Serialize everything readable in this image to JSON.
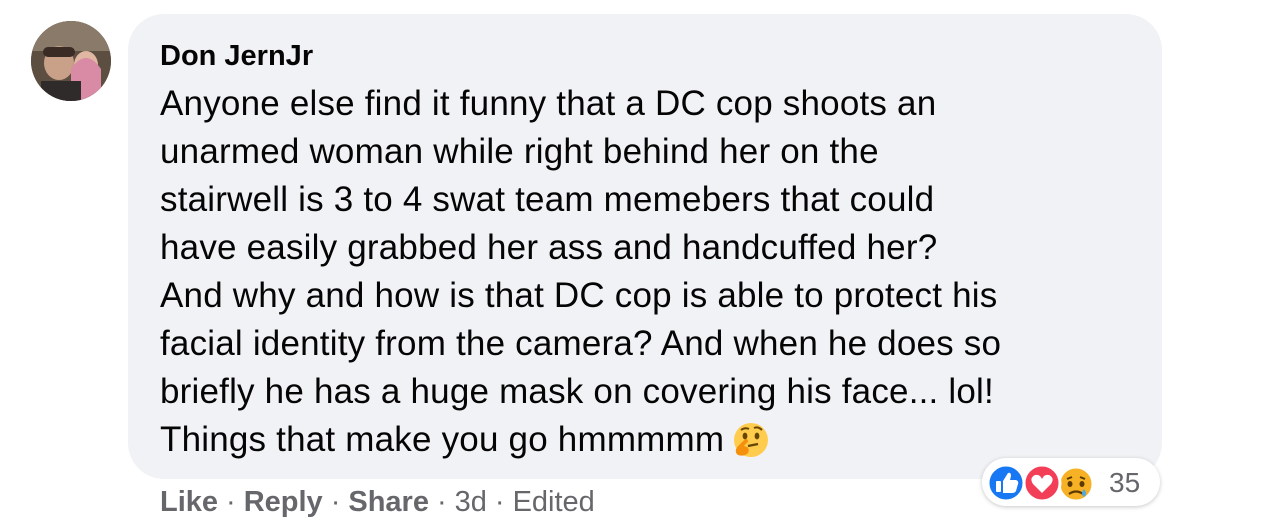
{
  "comment": {
    "author": "Don JernJr",
    "lines": [
      "Anyone else find it funny that a DC cop shoots an",
      "unarmed woman while right behind her on the",
      "stairwell is 3 to 4 swat team memebers that could",
      "have easily grabbed her ass and handcuffed her?",
      "And why and how is that DC cop is able to protect his",
      "facial identity from the camera? And when he does so",
      "briefly he has a huge mask on covering his face... lol!",
      "Things that make you go hmmmmm"
    ],
    "trailing_emoji": "thinking-face-emoji"
  },
  "reactions": {
    "types": [
      "like-icon",
      "love-icon",
      "sad-icon"
    ],
    "count": "35",
    "colors": {
      "like": "#1877f2",
      "love": "#f33e58",
      "sad": "#f7b125"
    }
  },
  "actions": {
    "like": "Like",
    "reply": "Reply",
    "share": "Share",
    "time": "3d",
    "edited": "Edited",
    "separator": "·"
  },
  "colors": {
    "bubble": "#f0f2f5",
    "meta_text": "#65676b",
    "text": "#050505"
  }
}
